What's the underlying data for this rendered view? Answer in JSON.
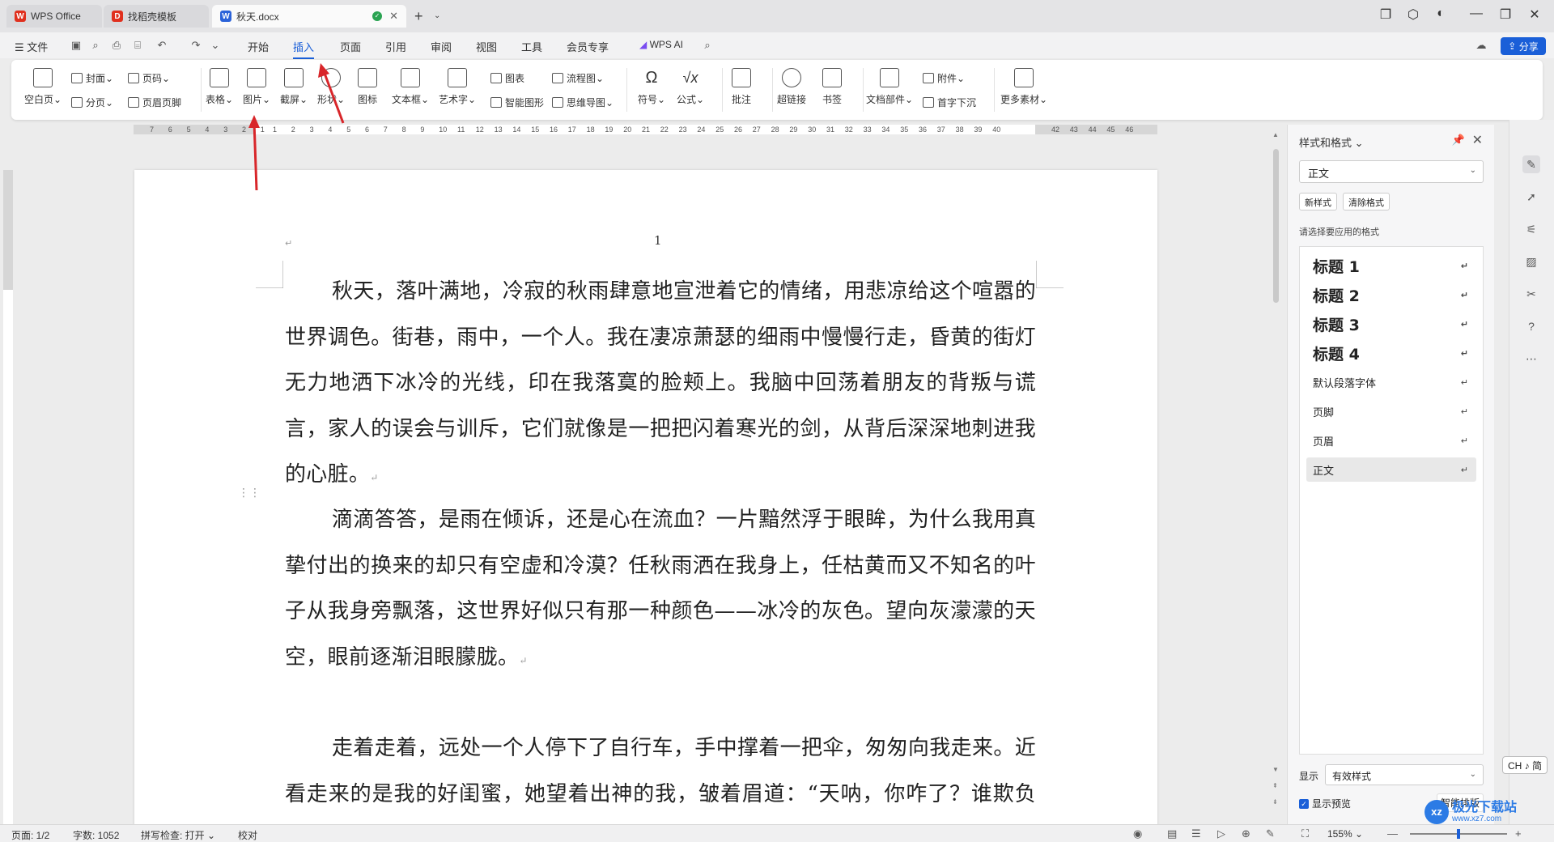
{
  "titlebar": {
    "tabs": [
      {
        "label": "WPS Office",
        "icon": "wps-logo-icon"
      },
      {
        "label": "找稻壳模板",
        "icon": "docer-logo-icon"
      },
      {
        "label": "秋天.docx",
        "icon": "word-doc-icon"
      }
    ]
  },
  "menubar": {
    "file": "文件",
    "items": [
      "开始",
      "插入",
      "页面",
      "引用",
      "审阅",
      "视图",
      "工具",
      "会员专享"
    ],
    "active": "插入",
    "wps_ai": "WPS AI",
    "share": "分享"
  },
  "ribbon": {
    "blank_page": "空白页",
    "cover": "封面",
    "page_break": "分页",
    "page_number": "页码",
    "header_footer": "页眉页脚",
    "table": "表格",
    "picture": "图片",
    "screenshot": "截屏",
    "shape": "形状",
    "icon": "图标",
    "textbox": "文本框",
    "wordart": "艺术字",
    "chart": "图表",
    "smart_graphic": "智能图形",
    "flowchart": "流程图",
    "mindmap": "思维导图",
    "symbol": "符号",
    "formula": "公式",
    "comment": "批注",
    "hyperlink": "超链接",
    "bookmark": "书签",
    "doc_parts": "文档部件",
    "attachment": "附件",
    "drop_cap": "首字下沉",
    "more": "更多素材"
  },
  "ruler": {
    "left_ticks": [
      "7",
      "6",
      "5",
      "4",
      "3",
      "2",
      "1"
    ],
    "right_ticks": [
      "1",
      "2",
      "3",
      "4",
      "5",
      "6",
      "7",
      "8",
      "9",
      "10",
      "11",
      "12",
      "13",
      "14",
      "15",
      "16",
      "17",
      "18",
      "19",
      "20",
      "21",
      "22",
      "23",
      "24",
      "25",
      "26",
      "27",
      "28",
      "29",
      "30",
      "31",
      "32",
      "33",
      "34",
      "35",
      "36",
      "37",
      "38",
      "39",
      "40"
    ],
    "margin_ticks": [
      "42",
      "43",
      "44",
      "45",
      "46"
    ]
  },
  "document": {
    "page_number": "1",
    "paragraphs": [
      "秋天，落叶满地，冷寂的秋雨肆意地宣泄着它的情绪，用悲凉给这个喧嚣的世界调色。街巷，雨中，一个人。我在凄凉萧瑟的细雨中慢慢行走，昏黄的街灯无力地洒下冰冷的光线，印在我落寞的脸颊上。我脑中回荡着朋友的背叛与谎言，家人的误会与训斥，它们就像是一把把闪着寒光的剑，从背后深深地刺进我的心脏。",
      "滴滴答答，是雨在倾诉，还是心在流血？一片黯然浮于眼眸，为什么我用真挚付出的换来的却只有空虚和冷漠？任秋雨洒在我身上，任枯黄而又不知名的叶子从我身旁飘落，这世界好似只有那一种颜色——冰冷的灰色。望向灰濛濛的天空，眼前逐渐泪眼朦胧。",
      "走着走着，远处一个人停下了自行车，手中撑着一把伞，匆匆向我走来。近看走来的是我的好闺蜜，她望着出神的我，皱着眉道：“天呐，你咋了？谁欺负你了？”我连忙擦了擦眼角的泪，强颜欢笑道：“只是碰到"
    ],
    "para_mark": "↵"
  },
  "panel": {
    "title": "样式和格式",
    "current_style": "正文",
    "new_style": "新样式",
    "clear_format": "清除格式",
    "hint": "请选择要应用的格式",
    "styles": [
      {
        "label": "标题 1",
        "kind": "heading"
      },
      {
        "label": "标题 2",
        "kind": "heading"
      },
      {
        "label": "标题 3",
        "kind": "heading"
      },
      {
        "label": "标题 4",
        "kind": "heading"
      },
      {
        "label": "默认段落字体",
        "kind": "normal"
      },
      {
        "label": "页脚",
        "kind": "normal"
      },
      {
        "label": "页眉",
        "kind": "normal"
      },
      {
        "label": "正文",
        "kind": "normal",
        "selected": true
      }
    ],
    "display_label": "显示",
    "display_value": "有效样式",
    "show_preview": "显示预览",
    "smart_layout": "智能排版"
  },
  "ime": "CH ♪ 简",
  "status": {
    "page": "页面: 1/2",
    "words": "字数: 1052",
    "spellcheck": "拼写检查: 打开",
    "proof": "校对",
    "zoom": "155%"
  },
  "watermark": {
    "title": "极光下载站",
    "url": "www.xz7.com"
  }
}
